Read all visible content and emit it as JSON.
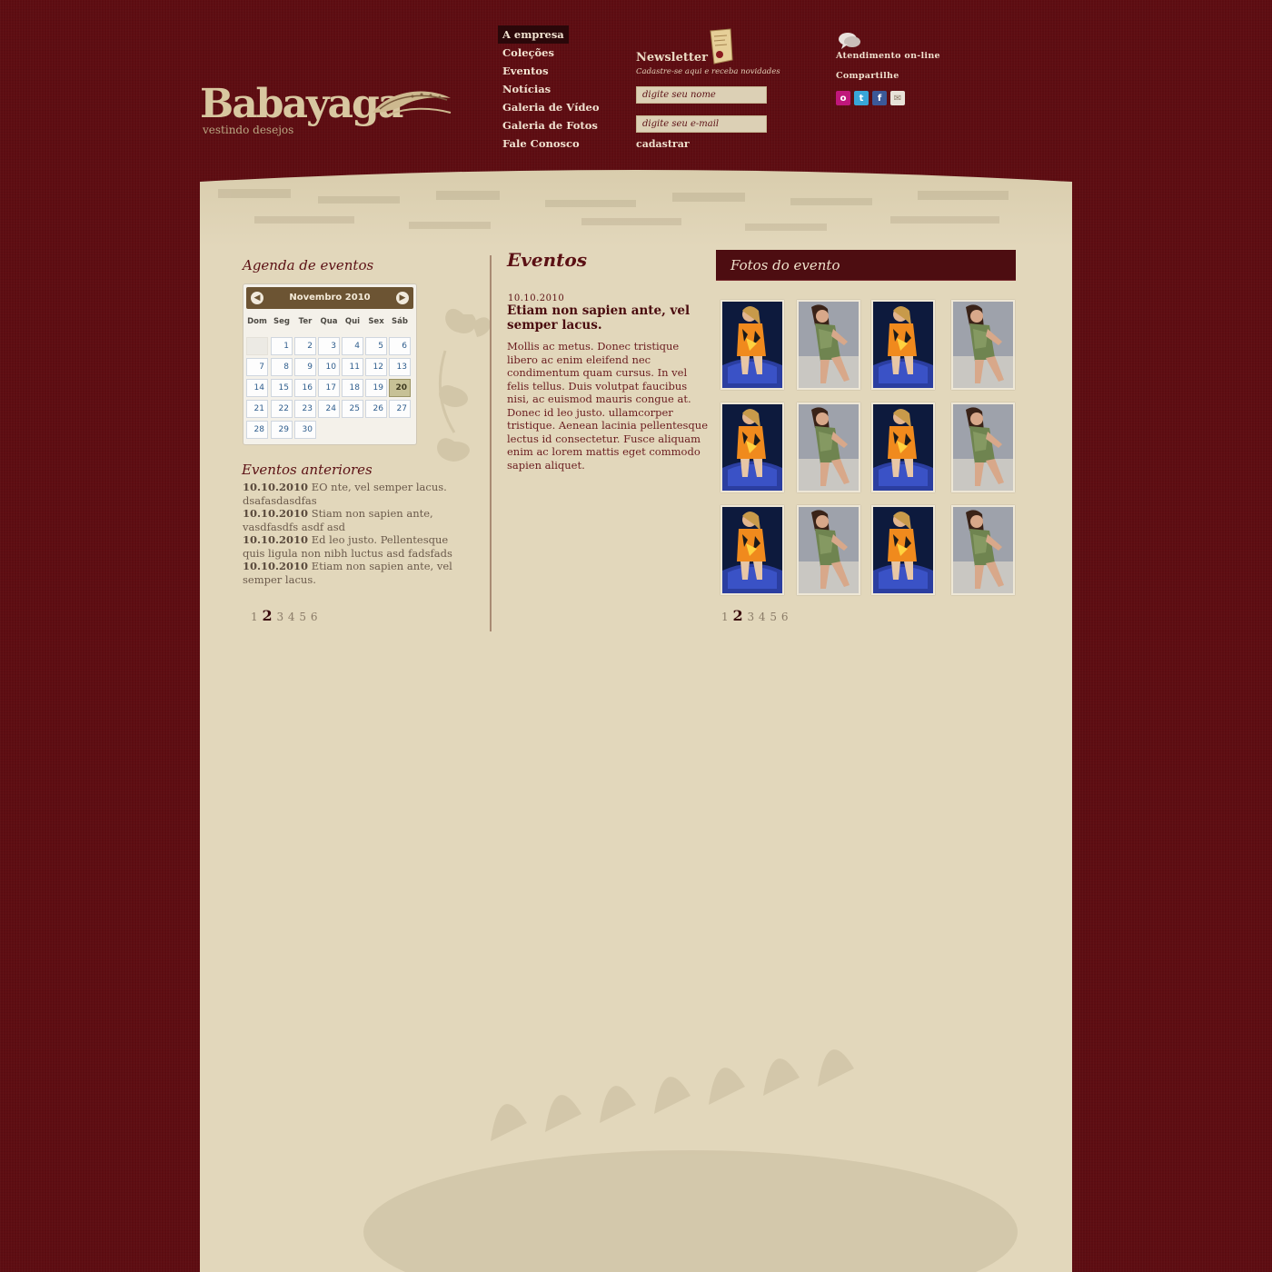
{
  "brand": {
    "name": "Babayaga",
    "tagline": "vestindo desejos"
  },
  "nav": [
    {
      "label": "A empresa",
      "active": true
    },
    {
      "label": "Coleções"
    },
    {
      "label": "Eventos"
    },
    {
      "label": "Notícias"
    },
    {
      "label": "Galeria de Vídeo"
    },
    {
      "label": "Galeria de Fotos"
    },
    {
      "label": "Fale Conosco"
    }
  ],
  "newsletter": {
    "title": "Newsletter",
    "subtitle": "Cadastre-se aqui e receba novidades",
    "name_placeholder": "digite seu nome",
    "email_placeholder": "digite seu e-mail",
    "submit_label": "cadastrar"
  },
  "top_right": {
    "support_label": "Atendimento on-line",
    "share_label": "Compartilhe",
    "socials": [
      "orkut-icon",
      "twitter-icon",
      "facebook-icon",
      "email-icon"
    ]
  },
  "agenda": {
    "title": "Agenda de eventos",
    "calendar": {
      "month_label": "Novembro 2010",
      "weekdays": [
        "Dom",
        "Seg",
        "Ter",
        "Qua",
        "Qui",
        "Sex",
        "Sáb"
      ],
      "first_weekday_index": 1,
      "days_in_month": 30,
      "today": 20
    }
  },
  "previous_events": {
    "title": "Eventos anteriores",
    "items": [
      {
        "date": "10.10.2010",
        "text": "EO nte, vel semper lacus. dsafasdasdfas"
      },
      {
        "date": "10.10.2010",
        "text": "Stiam non sapien ante, vasdfasdfs asdf asd"
      },
      {
        "date": "10.10.2010",
        "text": "Ed leo justo. Pellentesque quis ligula non nibh luctus asd fadsfads"
      },
      {
        "date": "10.10.2010",
        "text": "Etiam non sapien ante, vel semper lacus."
      }
    ],
    "pagination": {
      "pages": [
        "1",
        "2",
        "3",
        "4",
        "5",
        "6"
      ],
      "current": "2"
    }
  },
  "event": {
    "section_title": "Eventos",
    "date": "10.10.2010",
    "headline": "Etiam non sapien ante, vel semper lacus.",
    "body": "Mollis ac metus. Donec tristique libero ac enim eleifend nec condimentum quam cursus. In vel felis tellus. Duis volutpat faucibus nisi, ac euismod mauris congue at. Donec id leo justo. ullamcorper tristique. Aenean lacinia pellentesque lectus id consectetur. Fusce aliquam enim ac lorem mattis eget commodo sapien aliquet."
  },
  "photos": {
    "title": "Fotos do evento",
    "grid": [
      [
        "model-orange",
        "model-green",
        "model-orange",
        "model-green"
      ],
      [
        "model-orange",
        "model-green",
        "model-orange",
        "model-green"
      ],
      [
        "model-orange",
        "model-green",
        "model-orange",
        "model-green"
      ]
    ],
    "pagination": {
      "pages": [
        "1",
        "2",
        "3",
        "4",
        "5",
        "6"
      ],
      "current": "2"
    }
  },
  "colors": {
    "background": "#5e0d12",
    "panel": "#e2d7bb",
    "accent": "#5b1014",
    "calendar_header": "#6c5433"
  }
}
